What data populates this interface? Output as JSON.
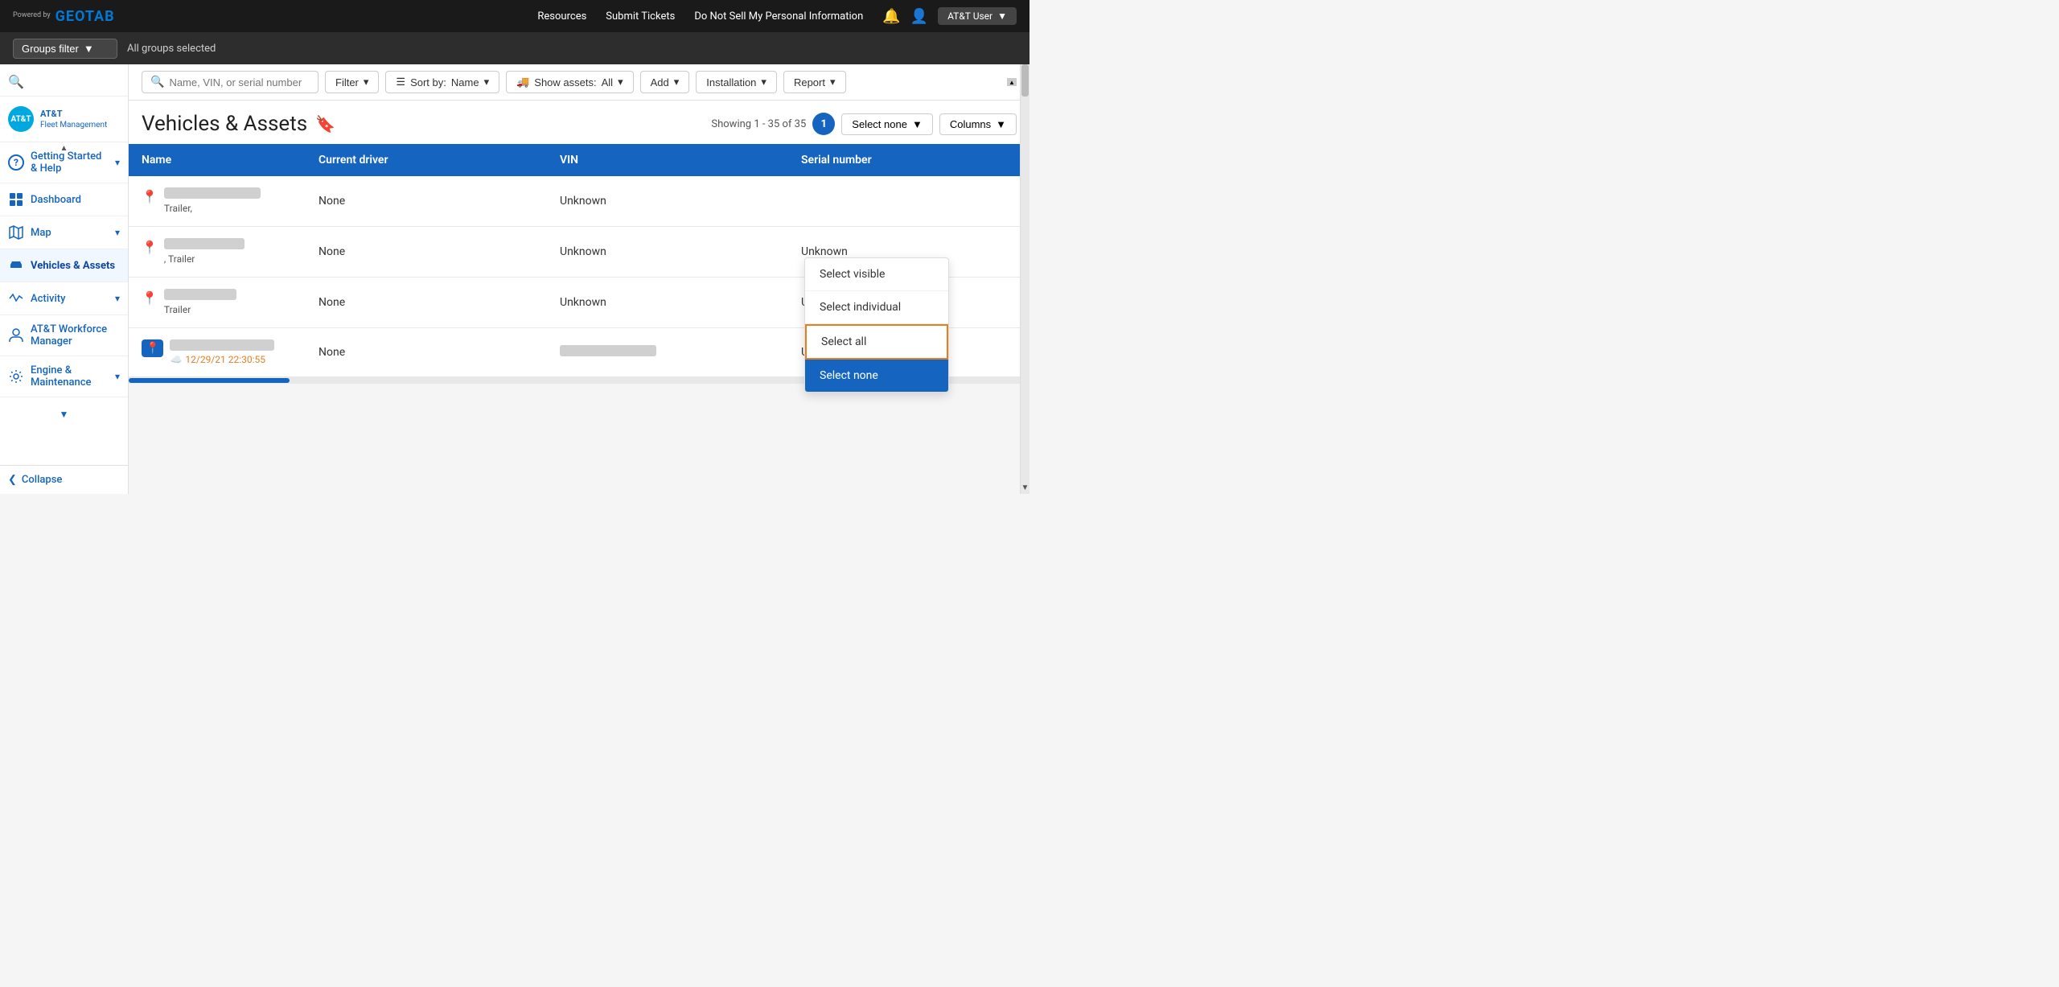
{
  "topnav": {
    "powered_by": "Powered\nby",
    "logo_text": "GEOTAB",
    "links": [
      "Resources",
      "Submit Tickets",
      "Do Not Sell My Personal Information"
    ],
    "bell_label": "🔔",
    "user_label": "👤",
    "user_name": "AT&T User",
    "caret": "▼"
  },
  "groups_bar": {
    "filter_label": "Groups filter",
    "filter_caret": "▼",
    "selected_text": "All groups selected"
  },
  "sidebar": {
    "logo_initials": "AT&T",
    "logo_title": "AT&T",
    "logo_subtitle": "Fleet Management",
    "search_icon": "🔍",
    "scroll_up": "▲",
    "scroll_down": "▼",
    "items": [
      {
        "id": "getting-started",
        "label": "Getting Started & Help",
        "icon": "?",
        "has_chevron": true
      },
      {
        "id": "dashboard",
        "label": "Dashboard",
        "icon": "📊",
        "has_chevron": false
      },
      {
        "id": "map",
        "label": "Map",
        "icon": "🗺",
        "has_chevron": true
      },
      {
        "id": "vehicles-assets",
        "label": "Vehicles & Assets",
        "icon": "🚚",
        "has_chevron": false,
        "active": true
      },
      {
        "id": "activity",
        "label": "Activity",
        "icon": "📈",
        "has_chevron": true
      },
      {
        "id": "att-workforce",
        "label": "AT&T Workforce Manager",
        "icon": "🧩",
        "has_chevron": false
      },
      {
        "id": "engine-maintenance",
        "label": "Engine & Maintenance",
        "icon": "🎬",
        "has_chevron": true
      }
    ],
    "collapse_label": "Collapse",
    "collapse_icon": "❮"
  },
  "toolbar": {
    "search_placeholder": "Name, VIN, or serial number",
    "search_icon": "🔍",
    "filter_label": "Filter",
    "filter_caret": "▼",
    "sort_label": "Sort by:",
    "sort_value": "Name",
    "sort_caret": "▼",
    "show_label": "Show assets:",
    "show_value": "All",
    "show_caret": "▼",
    "add_label": "Add",
    "add_caret": "▼",
    "installation_label": "Installation",
    "installation_caret": "▼",
    "report_label": "Report",
    "report_caret": "▼"
  },
  "page": {
    "title": "Vehicles & Assets",
    "bookmark_icon": "🔖",
    "showing_text": "Showing 1 - 35 of 35",
    "page_number": "1",
    "select_none_label": "Select none",
    "select_none_caret": "▼",
    "columns_label": "Columns",
    "columns_caret": "▼"
  },
  "table": {
    "headers": [
      "Name",
      "Current driver",
      "VIN",
      "Serial number"
    ],
    "rows": [
      {
        "name_blurred": true,
        "name_sub": "Trailer,",
        "name_sub2": "",
        "driver": "None",
        "vin": "Unknown",
        "serial": "",
        "has_pin": true,
        "pin_active": false,
        "timestamp": null
      },
      {
        "name_blurred": true,
        "name_sub": "",
        "name_sub2": ", Trailer",
        "driver": "None",
        "vin": "Unknown",
        "serial": "Unknown",
        "has_pin": true,
        "pin_active": false,
        "timestamp": null
      },
      {
        "name_blurred": true,
        "name_sub": "Trailer",
        "name_sub2": "",
        "driver": "None",
        "vin": "Unknown",
        "serial": "Unknown",
        "has_pin": true,
        "pin_active": false,
        "timestamp": null
      },
      {
        "name_blurred": true,
        "name_sub": "",
        "name_sub2": "",
        "driver": "None",
        "vin_blurred": true,
        "serial": "Unknown",
        "serial_blurred": true,
        "has_pin": true,
        "pin_active": true,
        "timestamp": "12/29/21 22:30:55"
      }
    ]
  },
  "dropdown": {
    "items": [
      {
        "id": "select-visible",
        "label": "Select visible",
        "highlighted": false,
        "selected": false
      },
      {
        "id": "select-individual",
        "label": "Select individual",
        "highlighted": false,
        "selected": false
      },
      {
        "id": "select-all",
        "label": "Select all",
        "highlighted": true,
        "selected": false
      },
      {
        "id": "select-none",
        "label": "Select none",
        "highlighted": false,
        "selected": true
      }
    ]
  }
}
